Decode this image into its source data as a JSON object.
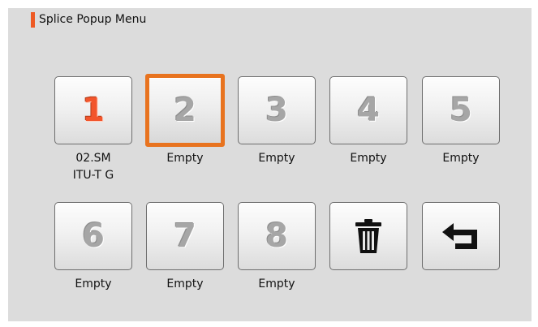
{
  "title": "Splice Popup Menu",
  "slots": [
    {
      "number": "1",
      "line1": "02.SM",
      "line2": "ITU-T G"
    },
    {
      "number": "2",
      "line1": "Empty",
      "line2": ""
    },
    {
      "number": "3",
      "line1": "Empty",
      "line2": ""
    },
    {
      "number": "4",
      "line1": "Empty",
      "line2": ""
    },
    {
      "number": "5",
      "line1": "Empty",
      "line2": ""
    },
    {
      "number": "6",
      "line1": "Empty",
      "line2": ""
    },
    {
      "number": "7",
      "line1": "Empty",
      "line2": ""
    },
    {
      "number": "8",
      "line1": "Empty",
      "line2": ""
    }
  ],
  "selected_slot": "2",
  "actions": {
    "delete_icon": "trash-icon",
    "back_icon": "return-arrow-icon"
  },
  "colors": {
    "accent": "#ee5a24",
    "selection": "#e8731f",
    "active_number": "#f2552c",
    "inactive_number": "#a6a6a6",
    "panel": "#dcdcdc"
  }
}
